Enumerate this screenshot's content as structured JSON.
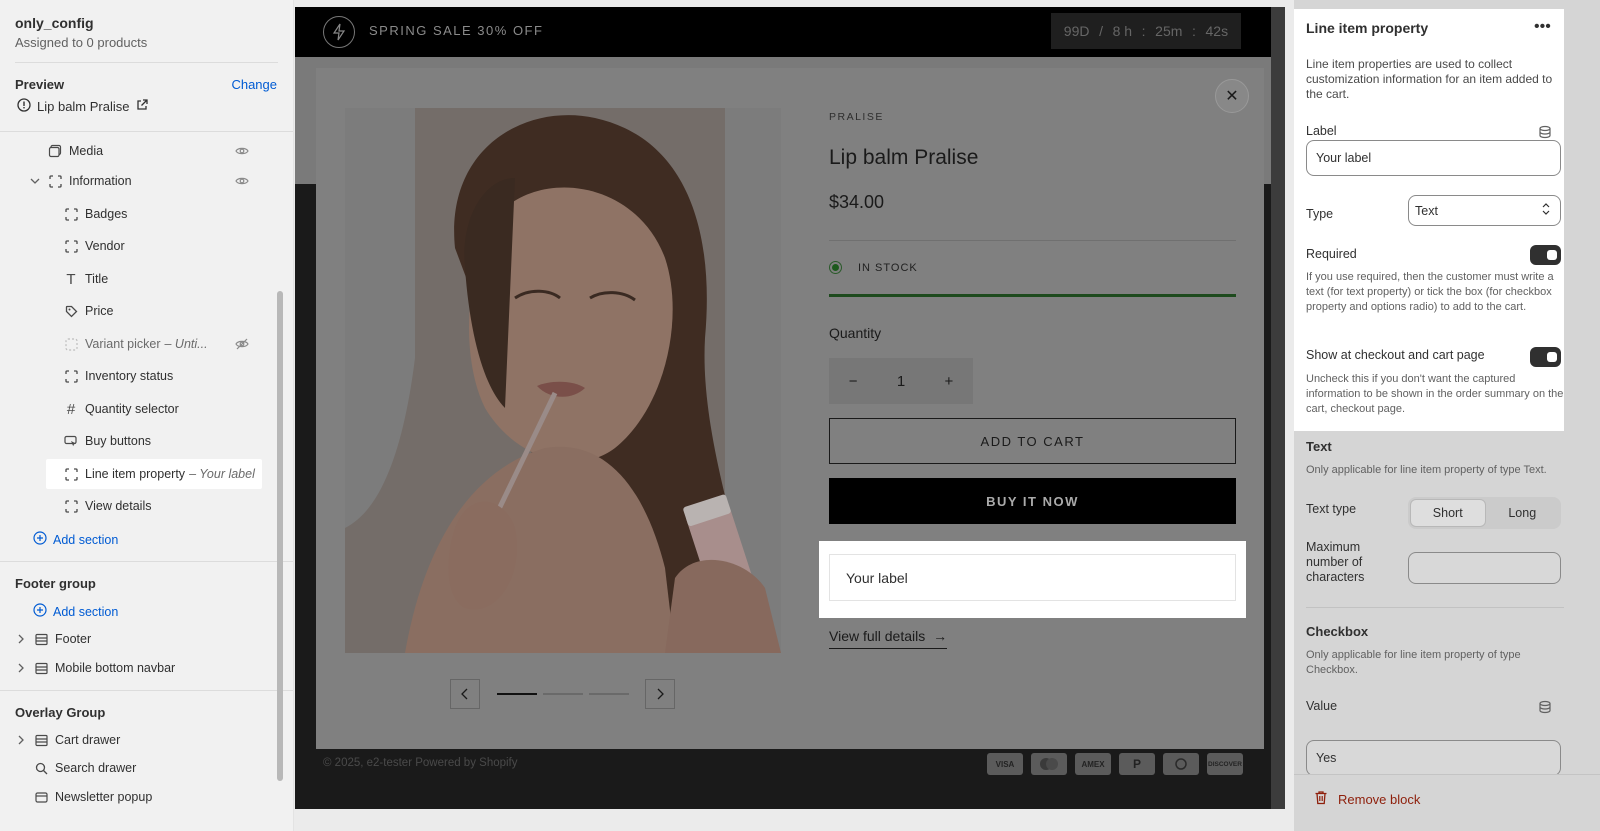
{
  "sidebar": {
    "template_name": "only_config",
    "assigned": "Assigned to 0 products",
    "preview_label": "Preview",
    "change_label": "Change",
    "preview_product": "Lip balm Pralise",
    "items": [
      {
        "label": "Media",
        "icon": "media-icon"
      },
      {
        "label": "Information",
        "icon": "block-icon"
      },
      {
        "label": "Badges",
        "icon": "block-icon"
      },
      {
        "label": "Vendor",
        "icon": "block-icon"
      },
      {
        "label": "Title",
        "icon": "text-icon"
      },
      {
        "label": "Price",
        "icon": "price-icon"
      },
      {
        "label": "Variant picker",
        "suffix": "– Unti...",
        "icon": "variant-icon"
      },
      {
        "label": "Inventory status",
        "icon": "block-icon"
      },
      {
        "label": "Quantity selector",
        "icon": "hash-icon"
      },
      {
        "label": "Buy buttons",
        "icon": "buy-icon"
      },
      {
        "label": "Line item property",
        "suffix": "– Your label",
        "icon": "block-icon"
      },
      {
        "label": "View details",
        "icon": "block-icon"
      }
    ],
    "add_section": "Add section",
    "footer_group": {
      "title": "Footer group",
      "add_section": "Add section",
      "items": [
        "Footer",
        "Mobile bottom navbar"
      ]
    },
    "overlay_group": {
      "title": "Overlay Group",
      "items": [
        "Cart drawer",
        "Search drawer",
        "Newsletter popup"
      ]
    }
  },
  "preview": {
    "announcement": "SPRING SALE 30% OFF",
    "timer": {
      "days": "99D",
      "sep": "/",
      "hours": "8 h",
      "minutes": "25m",
      "seconds": "42s",
      "colon": ":"
    },
    "modal": {
      "brand": "PRALISE",
      "title": "Lip balm Pralise",
      "price": "$34.00",
      "stock": "IN STOCK",
      "quantity_label": "Quantity",
      "quantity_value": "1",
      "minus": "−",
      "plus": "+",
      "add_to_cart": "ADD TO CART",
      "buy_now": "BUY IT NOW",
      "line_item_placeholder": "Your label",
      "view_full_details": "View full details",
      "close": "✕"
    },
    "footer": {
      "copyright": "© 2025, e2-tester Powered by Shopify",
      "payments": [
        "VISA",
        "MC",
        "AMEX",
        "PayPal",
        "Diners",
        "DISCOVER"
      ]
    }
  },
  "settings": {
    "title": "Line item property",
    "more": "•••",
    "description": "Line item properties are used to collect customization information for an item added to the cart.",
    "label_field": "Label",
    "label_value": "Your label",
    "type_field": "Type",
    "type_value": "Text",
    "required_field": "Required",
    "required_help": "If you use required, then the customer must write a text (for text property) or tick the box (for checkbox property and options radio) to add to the cart.",
    "show_checkout": "Show at checkout and cart page",
    "show_checkout_help": "Uncheck this if you don't want the captured information to be shown in the order summary on the cart, checkout page.",
    "text_section": "Text",
    "text_section_help": "Only applicable for line item property of type Text.",
    "text_type": "Text type",
    "text_type_options": [
      "Short",
      "Long"
    ],
    "max_chars": "Maximum number of characters",
    "max_chars_value": "",
    "checkbox_section": "Checkbox",
    "checkbox_help": "Only applicable for line item property of type Checkbox.",
    "value_field": "Value",
    "value_value": "Yes",
    "remove_block": "Remove block"
  }
}
